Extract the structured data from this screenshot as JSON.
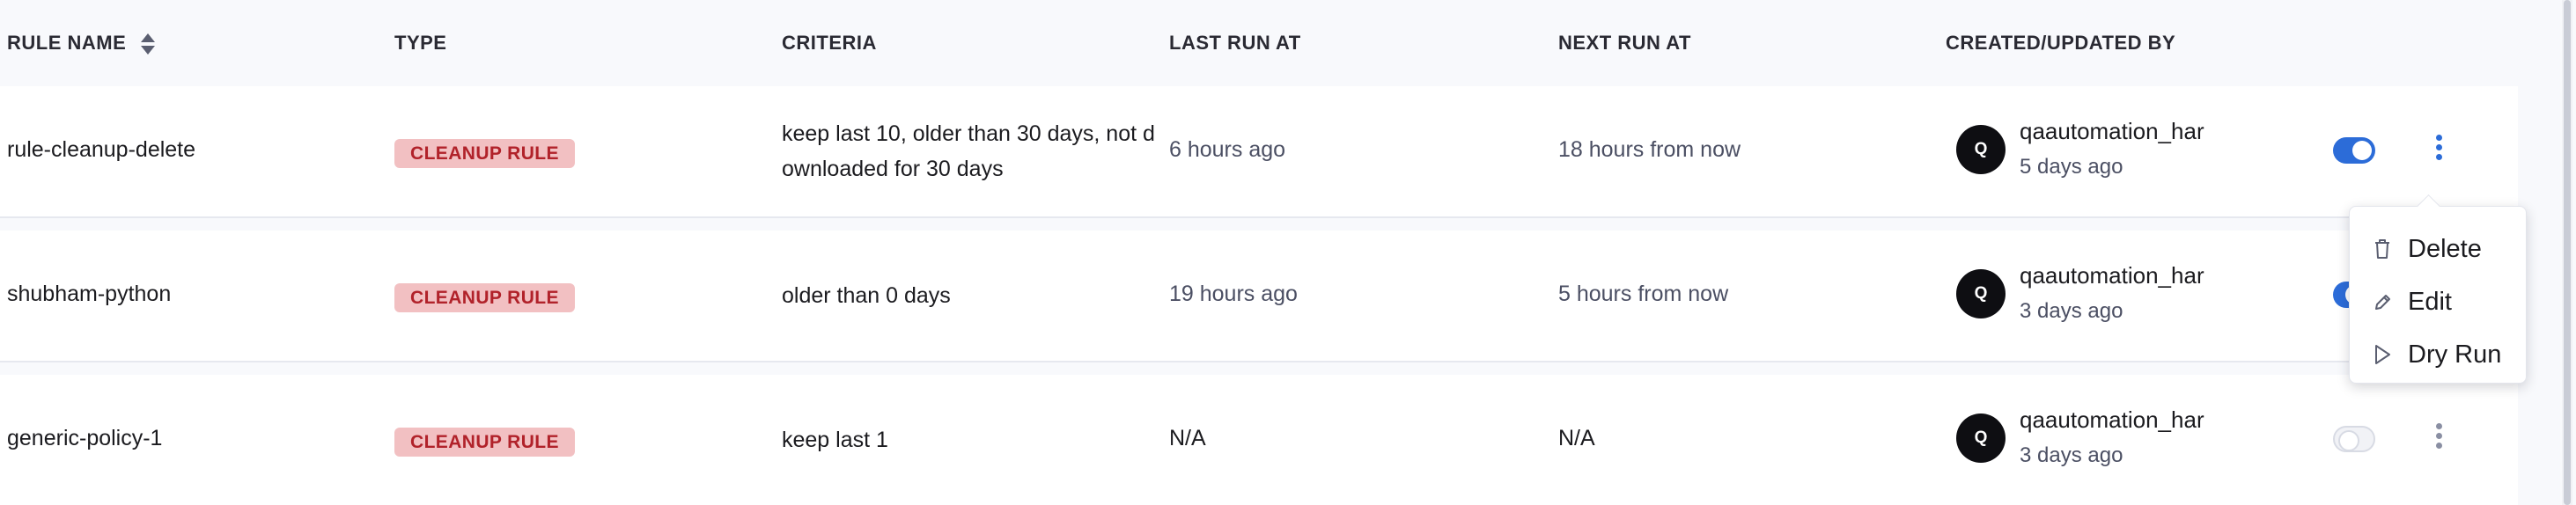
{
  "table": {
    "columns": {
      "rule_name": "RULE NAME",
      "type": "TYPE",
      "criteria": "CRITERIA",
      "last_run": "LAST RUN AT",
      "next_run": "NEXT RUN AT",
      "created_by": "CREATED/UPDATED BY"
    },
    "rows": [
      {
        "name": "rule-cleanup-delete",
        "type": "CLEANUP RULE",
        "criteria_line1": "keep last 10, older than 30 days, not d",
        "criteria_line2": "ownloaded for 30 days",
        "last_run": "6 hours ago",
        "next_run": "18 hours from now",
        "avatar": "Q",
        "user": "qaautomation_har",
        "updated": "5 days ago",
        "enabled": true
      },
      {
        "name": "shubham-python",
        "type": "CLEANUP RULE",
        "criteria": "older than 0 days",
        "last_run": "19 hours ago",
        "next_run": "5 hours from now",
        "avatar": "Q",
        "user": "qaautomation_har",
        "updated": "3 days ago",
        "enabled": true
      },
      {
        "name": "generic-policy-1",
        "type": "CLEANUP RULE",
        "criteria": "keep last 1",
        "last_run": "N/A",
        "next_run": "N/A",
        "avatar": "Q",
        "user": "qaautomation_har",
        "updated": "3 days ago",
        "enabled": false
      }
    ]
  },
  "context_menu": {
    "items": [
      {
        "label": "Delete",
        "icon": "trash-icon"
      },
      {
        "label": "Edit",
        "icon": "pencil-icon"
      },
      {
        "label": "Dry Run",
        "icon": "play-icon"
      }
    ]
  },
  "colors": {
    "accent": "#2c6cd8",
    "badge_bg": "#f2c0c2",
    "badge_text": "#b1222a"
  }
}
